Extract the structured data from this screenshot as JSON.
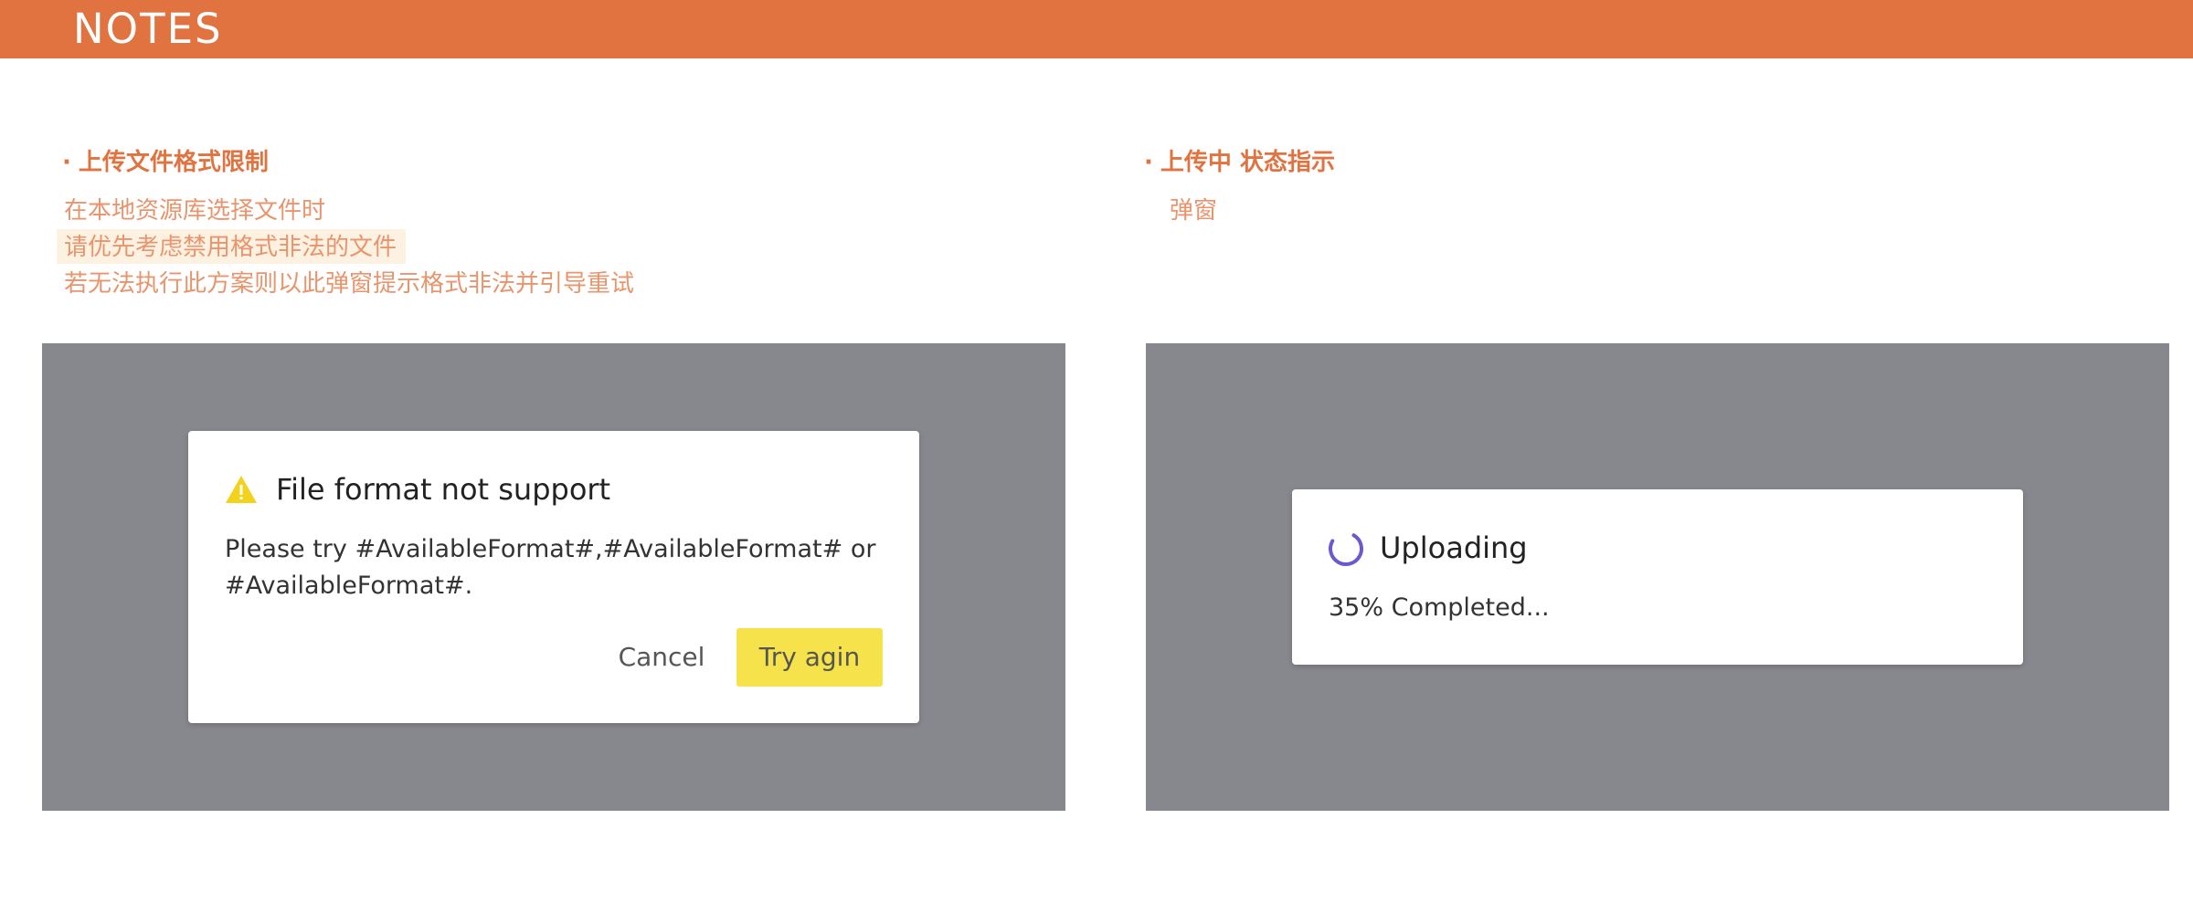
{
  "header": {
    "title": "NOTES"
  },
  "left_section": {
    "heading": "上传文件格式限制",
    "bullet": "·",
    "lines": [
      "在本地资源库选择文件时",
      "请优先考虑禁用格式非法的文件",
      "若无法执行此方案则以此弹窗提示格式非法并引导重试"
    ],
    "dialog": {
      "icon": "warning-icon",
      "title": "File format not support",
      "body": "Please try #AvailableFormat#,#AvailableFormat# or #AvailableFormat#.",
      "cancel_label": "Cancel",
      "retry_label": "Try agin"
    }
  },
  "right_section": {
    "heading": "上传中 状态指示",
    "bullet": "·",
    "lines": [
      "弹窗"
    ],
    "dialog": {
      "icon": "spinner-icon",
      "title": "Uploading",
      "progress_text": "35% Completed...",
      "progress_fraction": 0.35
    }
  },
  "colors": {
    "accent": "#e07340",
    "note_text": "#e8956d",
    "highlight_bg": "#fdf1e2",
    "overlay": "#87878e",
    "primary_button": "#f6e24a",
    "warning_icon": "#f2d21b",
    "spinner": "#6a5acd"
  }
}
